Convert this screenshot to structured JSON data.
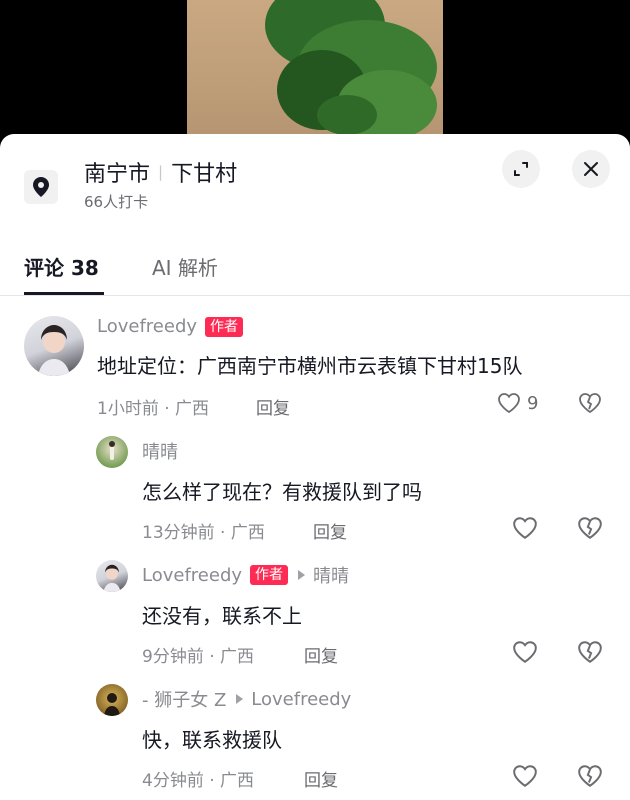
{
  "location": {
    "city": "南宁市",
    "village": "下甘村",
    "checkins": "66人打卡"
  },
  "tabs": [
    {
      "label": "评论 38"
    },
    {
      "label": "AI 解析"
    }
  ],
  "comments": [
    {
      "author": "Lovefreedy",
      "badge": "作者",
      "text": "地址定位：广西南宁市横州市云表镇下甘村15队",
      "meta": "1小时前 · 广西",
      "reply": "回复",
      "likes": "9"
    },
    {
      "author": "晴晴",
      "text": "怎么样了现在？有救援队到了吗",
      "meta": "13分钟前 · 广西",
      "reply": "回复"
    },
    {
      "author": "Lovefreedy",
      "badge": "作者",
      "reply_to": "晴晴",
      "text": "还没有，联系不上",
      "meta": "9分钟前 · 广西",
      "reply": "回复"
    },
    {
      "author": "- 狮子女 Z",
      "reply_to": "Lovefreedy",
      "text": "快，联系救援队",
      "meta": "4分钟前 · 广西",
      "reply": "回复"
    }
  ],
  "colors": {
    "accent": "#fe2c55",
    "text_primary": "#161823",
    "text_secondary": "#8a8b91"
  }
}
